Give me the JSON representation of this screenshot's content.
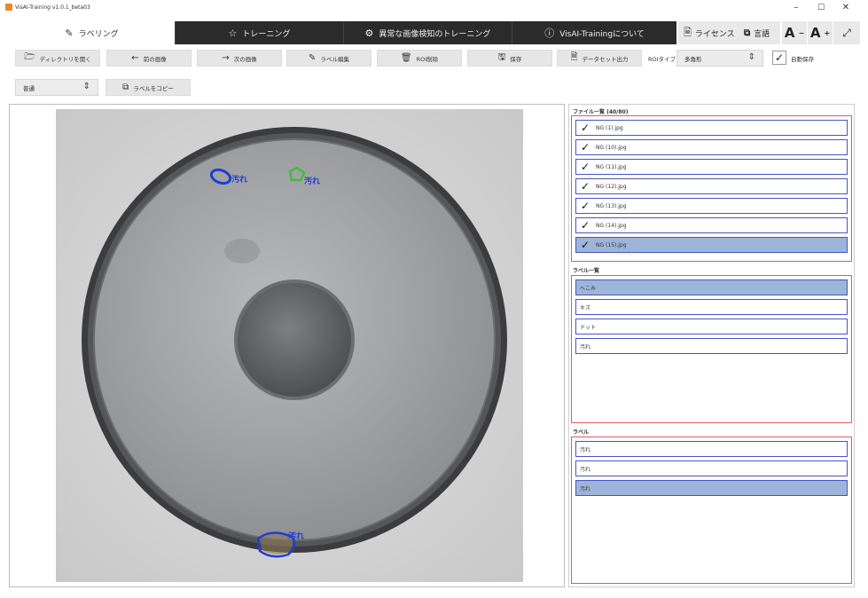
{
  "window": {
    "title": "VisAI-Training v1.0.1_beta03",
    "minimize": "–",
    "maximize": "☐",
    "close": "✕"
  },
  "tabs": [
    {
      "label": "ラベリング",
      "icon": "label-icon"
    },
    {
      "label": "トレーニング",
      "icon": "star-icon"
    },
    {
      "label": "異常な画像検知のトレーニング",
      "icon": "gear-icon"
    },
    {
      "label": "VisAI-Trainingについて",
      "icon": "info-icon"
    }
  ],
  "header_tools": {
    "license": "ライセンス",
    "language": "言語",
    "font_decrease": "A",
    "font_increase": "A",
    "pin": "⤢"
  },
  "toolbar": {
    "open_dir": "ディレクトリを開く",
    "prev_image": "前の画像",
    "next_image": "次の画像",
    "edit_label": "ラベル編集",
    "delete_roi": "ROI削除",
    "save": "保存",
    "export_dataset": "データセット出力",
    "roi_type_label": "ROIタイプ",
    "roi_type_value": "多角形",
    "auto_save": "自動保存",
    "auto_save_checked": true
  },
  "row2": {
    "mode_value": "普通",
    "copy_label": "ラベルをコピー"
  },
  "file_list": {
    "title": "ファイル一覧 (40/80)",
    "items": [
      {
        "name": "NG (1).jpg",
        "checked": true,
        "selected": false
      },
      {
        "name": "NG (10).jpg",
        "checked": true,
        "selected": false
      },
      {
        "name": "NG (11).jpg",
        "checked": true,
        "selected": false
      },
      {
        "name": "NG (12).jpg",
        "checked": true,
        "selected": false
      },
      {
        "name": "NG (13).jpg",
        "checked": true,
        "selected": false
      },
      {
        "name": "NG (14).jpg",
        "checked": true,
        "selected": false
      },
      {
        "name": "NG (15).jpg",
        "checked": true,
        "selected": true
      }
    ]
  },
  "label_list": {
    "title": "ラベル一覧",
    "items": [
      {
        "name": "へこみ",
        "selected": true
      },
      {
        "name": "キズ",
        "selected": false
      },
      {
        "name": "ドット",
        "selected": false
      },
      {
        "name": "汚れ",
        "selected": false
      }
    ]
  },
  "label_panel": {
    "title": "ラベル",
    "items": [
      {
        "name": "汚れ",
        "selected": false
      },
      {
        "name": "汚れ",
        "selected": false
      },
      {
        "name": "汚れ",
        "selected": true
      }
    ]
  },
  "annotations": [
    {
      "label": "汚れ",
      "color": "#1f3fd1"
    },
    {
      "label": "汚れ",
      "color": "#3cbf3c"
    },
    {
      "label": "汚れ",
      "color": "#1f3fd1"
    }
  ],
  "colors": {
    "dark_tab": "#2b2b2b",
    "selected_row": "#9db5d8",
    "item_border": "#4a53c7",
    "section_border": "#e25a5a"
  }
}
